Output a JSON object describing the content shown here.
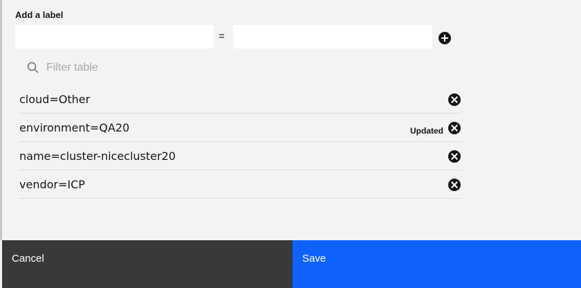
{
  "form": {
    "heading": "Add a label",
    "key_value": "",
    "value_value": "",
    "separator": "=",
    "add_icon": "add-filled-icon"
  },
  "filter": {
    "placeholder": "Filter table",
    "icon": "search-icon"
  },
  "labels": [
    {
      "text": "cloud=Other",
      "status": ""
    },
    {
      "text": "environment=QA20",
      "status": "Updated"
    },
    {
      "text": "name=cluster-nicecluster20",
      "status": ""
    },
    {
      "text": "vendor=ICP",
      "status": ""
    }
  ],
  "footer": {
    "cancel_label": "Cancel",
    "save_label": "Save"
  },
  "colors": {
    "save_bg": "#0f62fe",
    "cancel_bg": "#393939",
    "panel_bg": "#f3f3f3"
  }
}
